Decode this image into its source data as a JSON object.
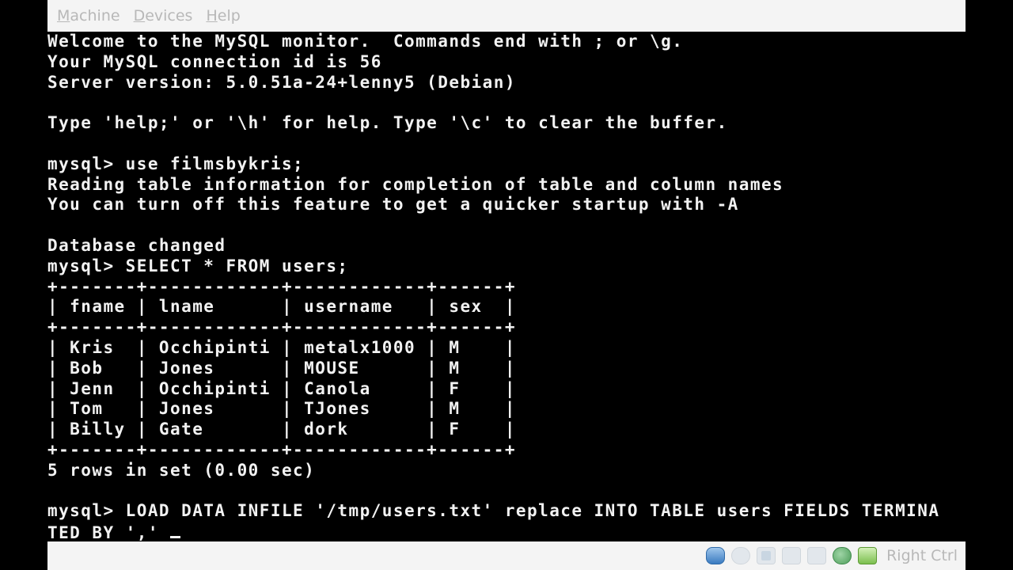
{
  "menu": {
    "items": [
      {
        "mnemonic": "M",
        "rest": "achine"
      },
      {
        "mnemonic": "D",
        "rest": "evices"
      },
      {
        "mnemonic": "H",
        "rest": "elp"
      }
    ]
  },
  "terminal": {
    "lines": [
      "Welcome to the MySQL monitor.  Commands end with ; or \\g.",
      "Your MySQL connection id is 56",
      "Server version: 5.0.51a-24+lenny5 (Debian)",
      "",
      "Type 'help;' or '\\h' for help. Type '\\c' to clear the buffer.",
      "",
      "mysql> use filmsbykris;",
      "Reading table information for completion of table and column names",
      "You can turn off this feature to get a quicker startup with -A",
      "",
      "Database changed",
      "mysql> SELECT * FROM users;",
      "+-------+------------+------------+------+",
      "| fname | lname      | username   | sex  |",
      "+-------+------------+------------+------+",
      "| Kris  | Occhipinti | metalx1000 | M    |",
      "| Bob   | Jones      | MOUSE      | M    |",
      "| Jenn  | Occhipinti | Canola     | F    |",
      "| Tom   | Jones      | TJones     | M    |",
      "| Billy | Gate       | dork       | F    |",
      "+-------+------------+------------+------+",
      "5 rows in set (0.00 sec)",
      "",
      "mysql> LOAD DATA INFILE '/tmp/users.txt' replace INTO TABLE users FIELDS TERMINA",
      "TED BY ',' "
    ]
  },
  "statusbar": {
    "icons": [
      "hard-disk-icon",
      "cd-drive-icon",
      "network-icon",
      "usb-icon",
      "shared-folder-icon",
      "globe-icon",
      "green-status-icon"
    ],
    "host_key": "Right Ctrl"
  },
  "colors": {
    "terminal_bg": "#000000",
    "terminal_fg": "#f2f2f2",
    "chrome_bg": "#f4f4f4",
    "chrome_text": "#b8b8b8"
  }
}
